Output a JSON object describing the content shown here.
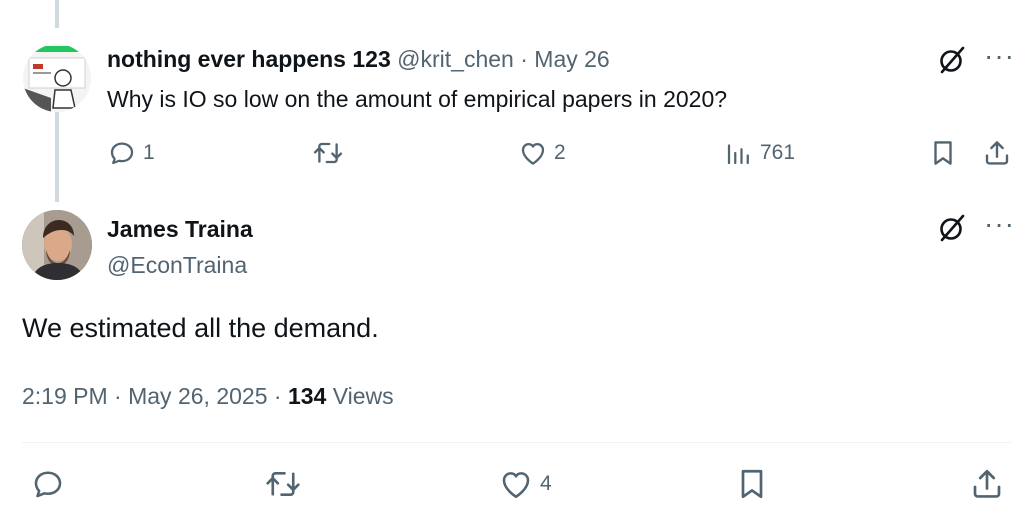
{
  "parent_tweet": {
    "display_name": "nothing ever happens 123",
    "handle": "@krit_chen",
    "separator": "·",
    "date": "May 26",
    "text": "Why is IO so low on the amount of empirical papers in 2020?",
    "replies": "1",
    "retweets": "",
    "likes": "2",
    "views": "761"
  },
  "main_tweet": {
    "display_name": "James Traina",
    "handle": "@EconTraina",
    "text": "We estimated all the demand.",
    "time": "2:19 PM",
    "sep1": "·",
    "date": "May 26, 2025",
    "sep2": "·",
    "views_count": "134",
    "views_label": "Views",
    "likes": "4"
  },
  "colors": {
    "text": "#0f1419",
    "muted": "#536471",
    "thread_line": "#cfd9de",
    "divider": "#eff3f4"
  },
  "icons": {
    "grok": "grok-icon",
    "more": "more-icon",
    "reply": "reply-icon",
    "retweet": "retweet-icon",
    "like": "heart-icon",
    "views": "views-icon",
    "bookmark": "bookmark-icon",
    "share": "share-icon"
  },
  "more_glyph": "···"
}
